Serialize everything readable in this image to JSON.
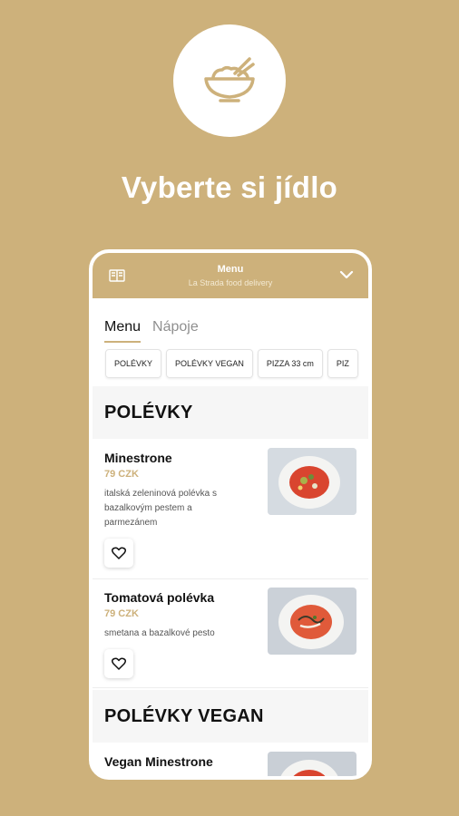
{
  "promo": {
    "headline": "Vyberte si jídlo",
    "logo_icon": "rice-bowl-icon"
  },
  "header": {
    "title": "Menu",
    "subtitle": "La Strada food delivery",
    "left_icon": "book-icon",
    "right_icon": "chevron-down-icon"
  },
  "tabs": [
    {
      "label": "Menu",
      "active": true
    },
    {
      "label": "Nápoje",
      "active": false
    }
  ],
  "categories": [
    "POLÉVKY",
    "POLÉVKY VEGAN",
    "PIZZA 33 cm",
    "PIZ"
  ],
  "sections": [
    {
      "title": "POLÉVKY",
      "items": [
        {
          "name": "Minestrone",
          "price": "79 CZK",
          "description": "italská zeleninová polévka s bazalkovým pestem a parmezánem"
        },
        {
          "name": "Tomatová polévka",
          "price": "79 CZK",
          "description": "smetana a bazalkové pesto"
        }
      ]
    },
    {
      "title": "POLÉVKY VEGAN",
      "items": [
        {
          "name": "Vegan Minestrone"
        }
      ]
    }
  ],
  "colors": {
    "accent": "#cdb17b",
    "background": "#cdb17b"
  }
}
